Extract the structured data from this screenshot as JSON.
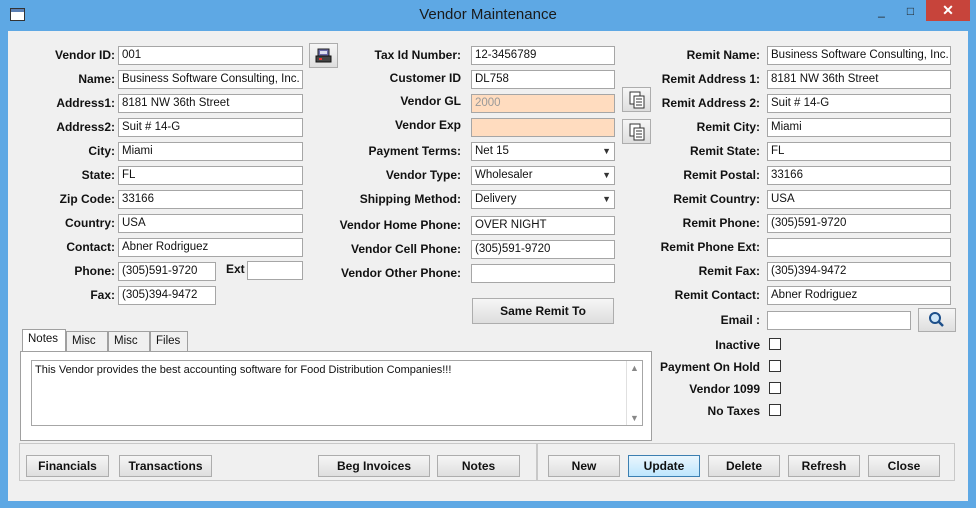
{
  "window": {
    "title": "Vendor Maintenance",
    "minimize": "_",
    "maximize": "□",
    "close": "✕"
  },
  "left": {
    "vendor_id": {
      "label": "Vendor ID:",
      "value": "001"
    },
    "name": {
      "label": "Name:",
      "value": "Business Software Consulting, Inc."
    },
    "address1": {
      "label": "Address1:",
      "value": "8181 NW 36th Street"
    },
    "address2": {
      "label": "Address2:",
      "value": "Suit # 14-G"
    },
    "city": {
      "label": "City:",
      "value": "Miami"
    },
    "state": {
      "label": "State:",
      "value": "FL"
    },
    "zip": {
      "label": "Zip Code:",
      "value": "33166"
    },
    "country": {
      "label": "Country:",
      "value": "USA"
    },
    "contact": {
      "label": "Contact:",
      "value": "Abner Rodriguez"
    },
    "phone": {
      "label": "Phone:",
      "value": "(305)591-9720"
    },
    "ext": {
      "label": "Ext",
      "value": ""
    },
    "fax": {
      "label": "Fax:",
      "value": "(305)394-9472"
    }
  },
  "middle": {
    "tax_id": {
      "label": "Tax Id Number:",
      "value": "12-3456789"
    },
    "customer_id": {
      "label": "Customer ID",
      "value": "DL758"
    },
    "vendor_gl": {
      "label": "Vendor GL",
      "value": "2000"
    },
    "vendor_exp": {
      "label": "Vendor Exp",
      "value": ""
    },
    "payment_terms": {
      "label": "Payment Terms:",
      "value": "Net 15"
    },
    "vendor_type": {
      "label": "Vendor Type:",
      "value": "Wholesaler"
    },
    "shipping_method": {
      "label": "Shipping Method:",
      "value": "Delivery"
    },
    "home_phone": {
      "label": "Vendor Home Phone:",
      "value": "OVER NIGHT"
    },
    "cell_phone": {
      "label": "Vendor Cell Phone:",
      "value": "(305)591-9720"
    },
    "other_phone": {
      "label": "Vendor Other Phone:",
      "value": ""
    },
    "same_remit_button": "Same Remit To"
  },
  "right": {
    "remit_name": {
      "label": "Remit Name:",
      "value": "Business Software Consulting, Inc."
    },
    "remit_address1": {
      "label": "Remit Address 1:",
      "value": "8181 NW 36th Street"
    },
    "remit_address2": {
      "label": "Remit Address 2:",
      "value": "Suit # 14-G"
    },
    "remit_city": {
      "label": "Remit City:",
      "value": "Miami"
    },
    "remit_state": {
      "label": "Remit State:",
      "value": "FL"
    },
    "remit_postal": {
      "label": "Remit Postal:",
      "value": "33166"
    },
    "remit_country": {
      "label": "Remit Country:",
      "value": "USA"
    },
    "remit_phone": {
      "label": "Remit Phone:",
      "value": "(305)591-9720"
    },
    "remit_phone_ext": {
      "label": "Remit Phone Ext:",
      "value": ""
    },
    "remit_fax": {
      "label": "Remit Fax:",
      "value": "(305)394-9472"
    },
    "remit_contact": {
      "label": "Remit Contact:",
      "value": "Abner Rodriguez"
    },
    "email": {
      "label": "Email :",
      "value": ""
    },
    "inactive": {
      "label": "Inactive",
      "checked": false
    },
    "payment_on_hold": {
      "label": "Payment On Hold",
      "checked": false
    },
    "vendor_1099": {
      "label": "Vendor 1099",
      "checked": false
    },
    "no_taxes": {
      "label": "No Taxes",
      "checked": false
    }
  },
  "tabs": {
    "items": [
      "Notes",
      "Misc",
      "Misc",
      "Files"
    ],
    "active": "Notes",
    "notes_text": "This Vendor provides the best accounting software for Food Distribution Companies!!!"
  },
  "bottom": {
    "financials": "Financials",
    "transactions": "Transactions",
    "beg_invoices": "Beg Invoices",
    "notes": "Notes",
    "new": "New",
    "update": "Update",
    "delete": "Delete",
    "refresh": "Refresh",
    "close": "Close"
  },
  "icons": {
    "lookup": "vendor-lookup-icon",
    "copy": "copy-icon",
    "search": "magnifier-icon"
  },
  "colors": {
    "title_bar": "#5ea8e4",
    "close_button": "#c7443b",
    "readonly_field": "#ffdcbf"
  }
}
